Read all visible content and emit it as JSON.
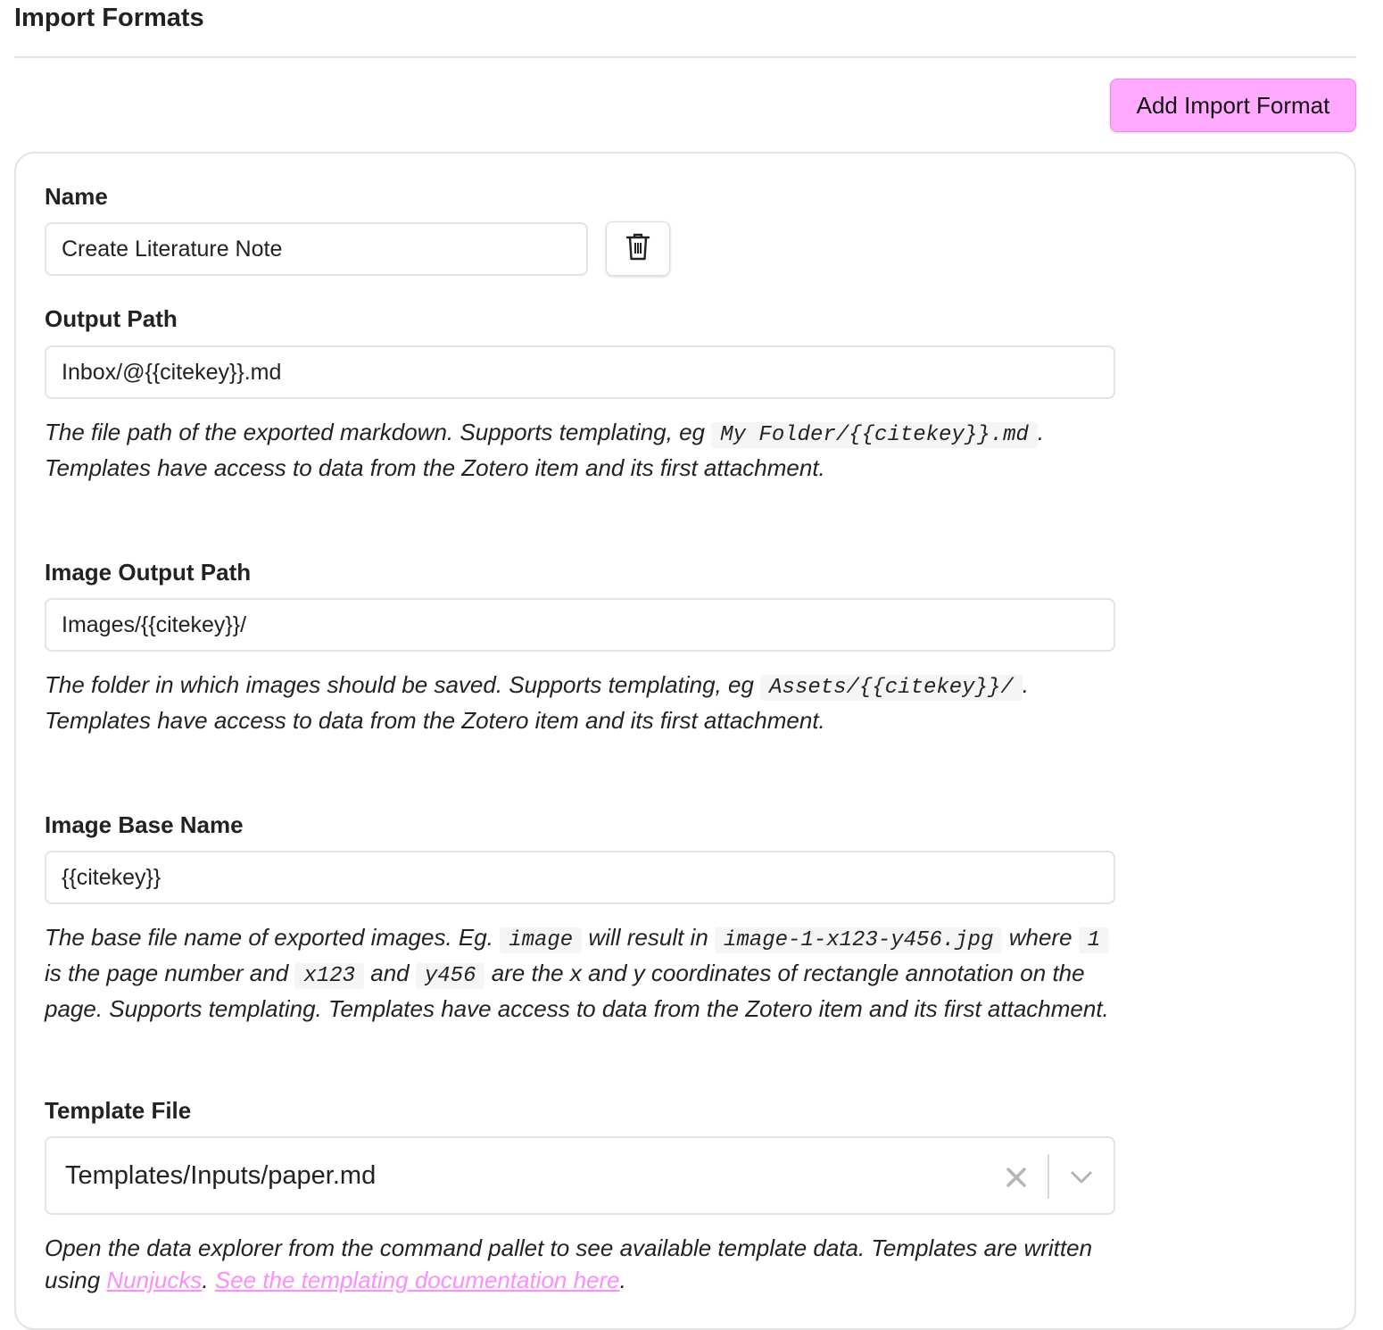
{
  "header": {
    "title": "Import Formats",
    "add_button_label": "Add Import Format"
  },
  "format": {
    "name": {
      "label": "Name",
      "value": "Create Literature Note"
    },
    "output_path": {
      "label": "Output Path",
      "value": "Inbox/@{{citekey}}.md",
      "desc_1": "The file path of the exported markdown. Supports templating, eg ",
      "code_1": "My Folder/{{citekey}}.md",
      "desc_2": ". Templates have access to data from the Zotero item and its first attachment."
    },
    "image_output_path": {
      "label": "Image Output Path",
      "value": "Images/{{citekey}}/",
      "desc_1": "The folder in which images should be saved. Supports templating, eg ",
      "code_1": "Assets/{{citekey}}/",
      "desc_2": ". Templates have access to data from the Zotero item and its first attachment."
    },
    "image_base_name": {
      "label": "Image Base Name",
      "value": "{{citekey}}",
      "desc_1": "The base file name of exported images. Eg. ",
      "code_1": "image",
      "desc_2": " will result in ",
      "code_2": "image-1-x123-y456.jpg",
      "desc_3": " where ",
      "code_3": "1",
      "desc_4": " is the page number and ",
      "code_4": "x123",
      "desc_5": " and ",
      "code_5": "y456",
      "desc_6": " are the x and y coordinates of rectangle annotation on the page. Supports templating. Templates have access to data from the Zotero item and its first attachment."
    },
    "template_file": {
      "label": "Template File",
      "value": "Templates/Inputs/paper.md",
      "desc_1": "Open the data explorer from the command pallet to see available template data. Templates are written using ",
      "link_1": "Nunjucks",
      "desc_2": ". ",
      "link_2": "See the templating documentation here",
      "desc_3": "."
    }
  },
  "icons": {
    "delete": "trash-icon",
    "clear": "close-icon",
    "dropdown": "chevron-down-icon"
  },
  "colors": {
    "accent": "#ffaaff",
    "link": "#ff8cff",
    "border": "#e3e3e3"
  }
}
